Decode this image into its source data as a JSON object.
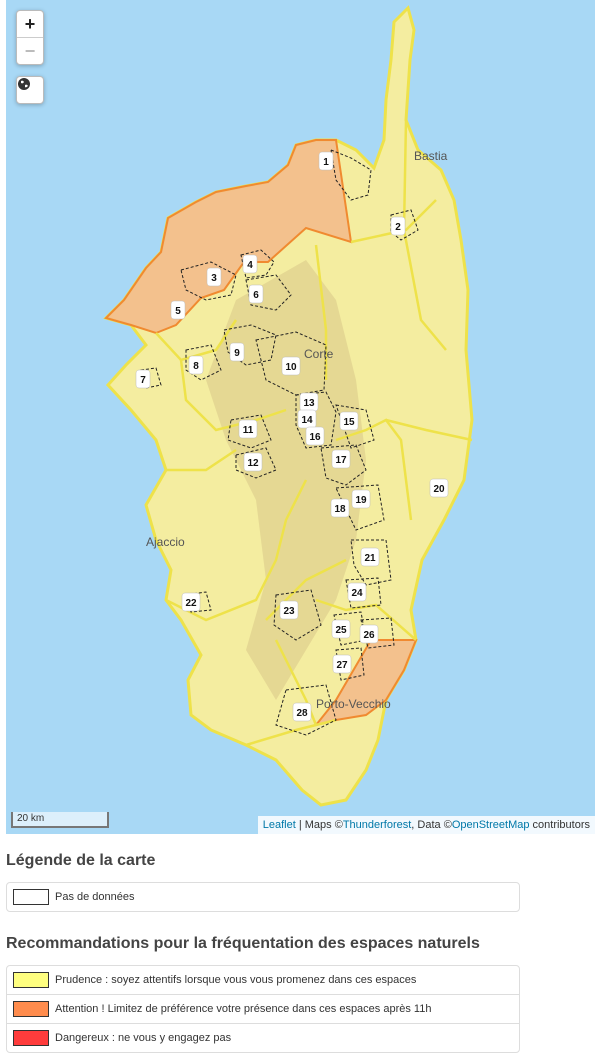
{
  "map": {
    "zoom_in_label": "+",
    "zoom_out_label": "−",
    "scale_label": "20 km",
    "attribution": {
      "leaflet": "Leaflet",
      "sep1": " | Maps ©",
      "thunderforest": "Thunderforest",
      "sep2": ", Data ©",
      "osm": "OpenStreetMap",
      "suffix": " contributors"
    },
    "cities": {
      "bastia": "Bastia",
      "corte": "Corte",
      "ajaccio": "Ajaccio",
      "porto_vecchio": "Porto-Vecchio"
    },
    "zones": [
      "1",
      "2",
      "3",
      "4",
      "5",
      "6",
      "7",
      "8",
      "9",
      "10",
      "11",
      "12",
      "13",
      "14",
      "15",
      "16",
      "17",
      "18",
      "19",
      "20",
      "21",
      "22",
      "23",
      "24",
      "25",
      "26",
      "27",
      "28"
    ],
    "colors": {
      "sea": "#a8d8f5",
      "prudence": "#fbf38a",
      "attention": "#f4a574",
      "dangereux": "#f03c3c",
      "border_yellow": "#eee24a",
      "border_orange": "#f08a30"
    }
  },
  "legend": {
    "title": "Légende de la carte",
    "no_data": "Pas de données"
  },
  "recommendations": {
    "title": "Recommandations pour la fréquentation des espaces naturels",
    "items": [
      {
        "label": "Prudence : soyez attentifs lorsque vous vous promenez dans ces espaces",
        "color": "#ffff80"
      },
      {
        "label": "Attention ! Limitez de préférence votre présence dans ces espaces après 11h",
        "color": "#ff8c4d"
      },
      {
        "label": "Dangereux : ne vous y engagez pas",
        "color": "#ff3c3c"
      }
    ]
  }
}
